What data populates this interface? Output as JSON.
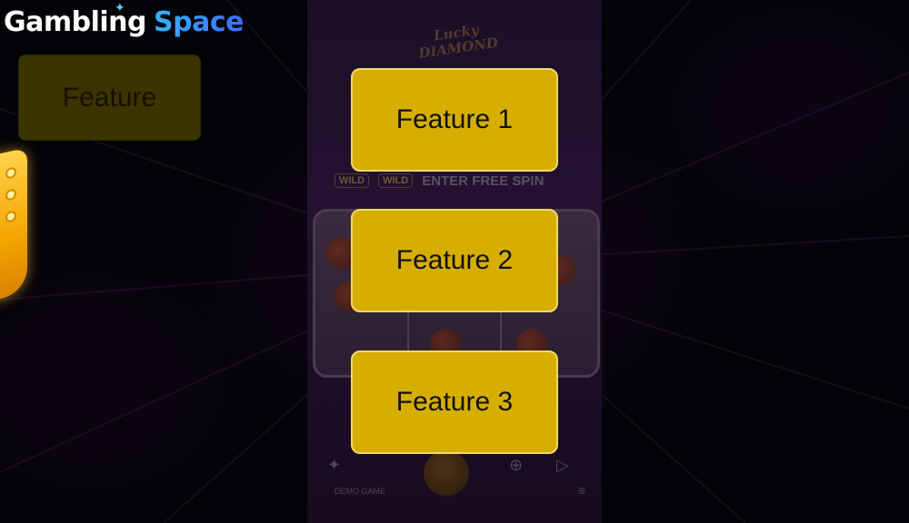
{
  "brand": {
    "name_part1": "Gambling",
    "name_part2": "Space"
  },
  "ghost_feature": {
    "label": "Feature"
  },
  "features": [
    {
      "label": "Feature 1"
    },
    {
      "label": "Feature 2"
    },
    {
      "label": "Feature 3"
    }
  ],
  "game": {
    "logo_line1": "Lucky",
    "logo_line2": "DIAMOND",
    "wild_label": "WILD",
    "free_spin_text": "ENTER FREE SPIN",
    "demo_label": "DEMO GAME"
  },
  "colors": {
    "feature_fill": "#d6ae00",
    "brand_accent": "#2fb6ff",
    "side_tab": "#f4a500"
  }
}
